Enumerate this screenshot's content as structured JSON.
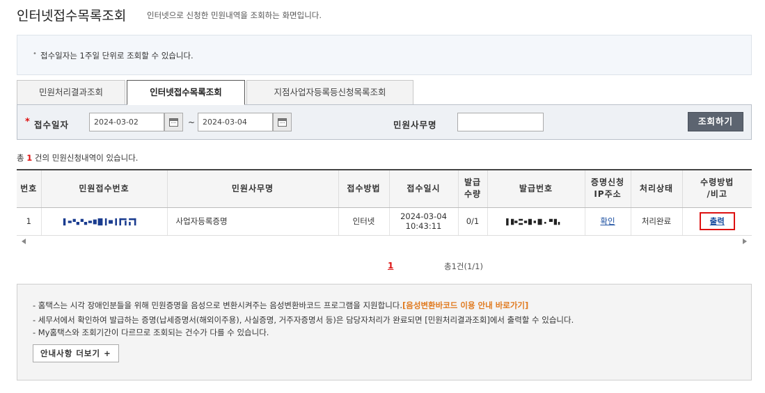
{
  "page": {
    "title": "인터넷접수목록조회",
    "subtitle": "인터넷으로 신청한 민원내역을 조회하는 화면입니다."
  },
  "notice": {
    "text": "접수일자는 1주일 단위로 조회할 수 있습니다."
  },
  "tabs": [
    {
      "label": "민원처리결과조회",
      "active": false
    },
    {
      "label": "인터넷접수목록조회",
      "active": true
    },
    {
      "label": "지점사업자등록등신청목록조회",
      "active": false
    }
  ],
  "search": {
    "date_label": "접수일자",
    "date_from": "2024-03-02",
    "date_to": "2024-03-04",
    "tilde": "~",
    "office_label": "민원사무명",
    "office_value": "",
    "button_label": "조회하기"
  },
  "count": {
    "prefix": "총",
    "number": "1",
    "suffix": "건의 민원신청내역이 있습니다."
  },
  "table": {
    "headers": [
      "번호",
      "민원접수번호",
      "민원사무명",
      "접수방법",
      "접수일시",
      "발급\n수량",
      "발급번호",
      "증명신청\nIP주소",
      "처리상태",
      "수령방법\n/비고"
    ],
    "rows": [
      {
        "no": "1",
        "office_name": "사업자등록증명",
        "method": "인터넷",
        "received_date": "2024-03-04",
        "received_time": "10:43:11",
        "qty": "0/1",
        "ip_link": "확인",
        "status": "처리완료",
        "action": "출력"
      }
    ]
  },
  "pager": {
    "current": "1",
    "total": "총1건(1/1)"
  },
  "info": {
    "line1_text": "- 홈택스는 시각 장애인분들을 위해 민원증명을 음성으로 변환시켜주는 음성변환바코드 프로그램을 지원합니다.",
    "line1_link": "[음성변환바코드 이용 안내 바로가기]",
    "line2": "- 세무서에서 확인하여 발급하는 증명(납세증명서(해외이주용), 사실증명, 거주자증명서 등)은 담당자처리가 완료되면 [민원처리결과조회]에서 출력할 수 있습니다.",
    "line3": "- My홈택스와 조회기간이 다르므로 조회되는 건수가 다를 수 있습니다.",
    "more_button": "안내사항 더보기 +"
  },
  "colors": {
    "required": "#dd1111",
    "link": "#1a4ea0",
    "highlight": "#e07a1f",
    "button_bg": "#5c6470"
  }
}
